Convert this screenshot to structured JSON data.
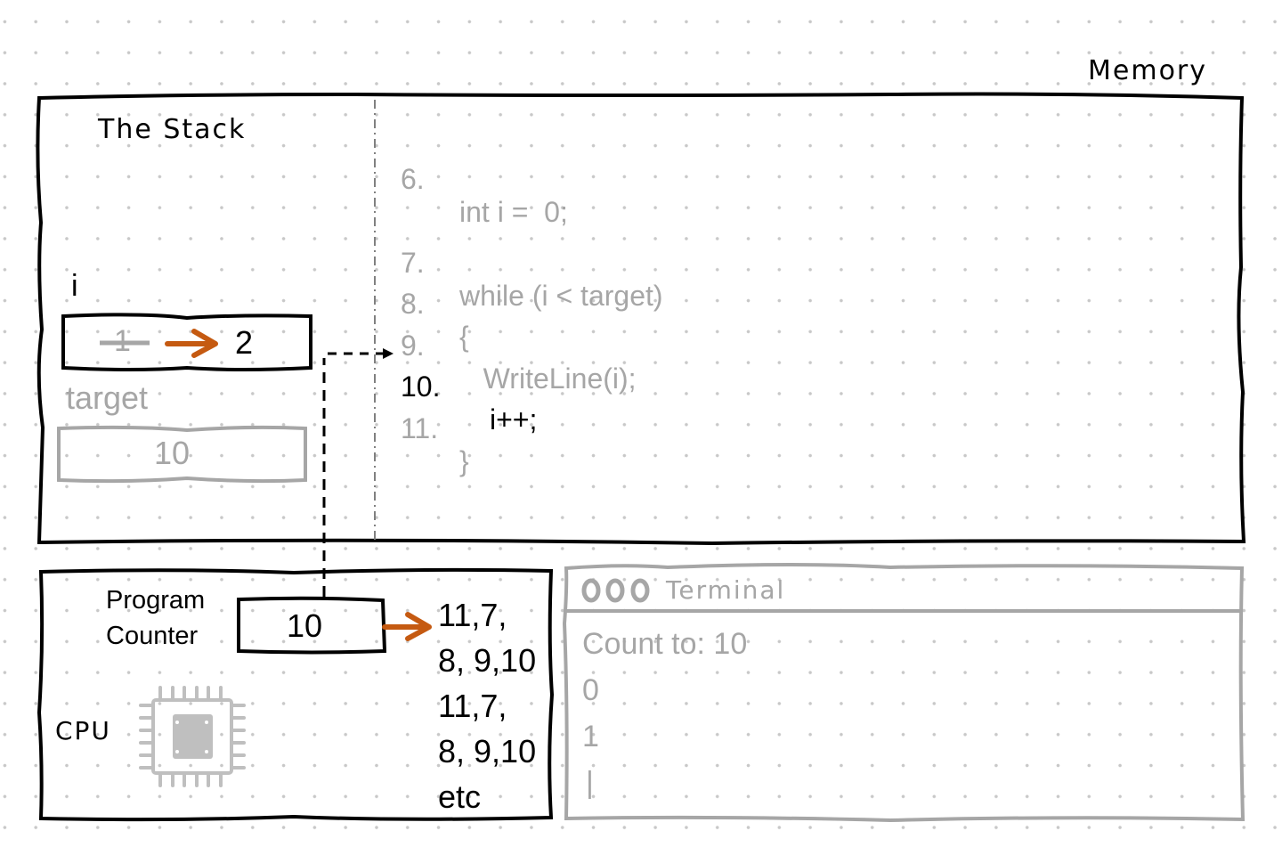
{
  "memory": {
    "label": "Memory",
    "stack": {
      "title": "The Stack",
      "variables": [
        {
          "name": "i",
          "old_value": "1",
          "new_value": "2",
          "active": true
        },
        {
          "name": "target",
          "value": "10",
          "active": false
        }
      ]
    },
    "code": {
      "current_line": 10,
      "lines": [
        {
          "num": "6.",
          "text": "int i =  0;",
          "active": false
        },
        {
          "num": "7.",
          "text": "while (i < target)",
          "active": false
        },
        {
          "num": "8.",
          "text": "{",
          "active": false
        },
        {
          "num": "9.",
          "text": "   WriteLine(i);",
          "active": false
        },
        {
          "num": "10.",
          "text": "i++;",
          "active": true
        },
        {
          "num": "11.",
          "text": "}",
          "active": false
        }
      ]
    }
  },
  "cpu": {
    "label": "CPU",
    "icon": "cpu-chip-icon",
    "program_counter": {
      "label_line1": "Program",
      "label_line2": "Counter",
      "value": "10"
    },
    "sequence": [
      "11,7,",
      "8, 9,10",
      "11,7,",
      "8, 9,10",
      "etc"
    ]
  },
  "terminal": {
    "title": "Terminal",
    "window_buttons_icon": "traffic-lights-icon",
    "lines": [
      "Count to: 10",
      "0",
      "1"
    ],
    "cursor": "|"
  },
  "colors": {
    "accent_arrow": "#c55a11",
    "inactive_gray": "#a6a6a6",
    "ink": "#000000"
  }
}
